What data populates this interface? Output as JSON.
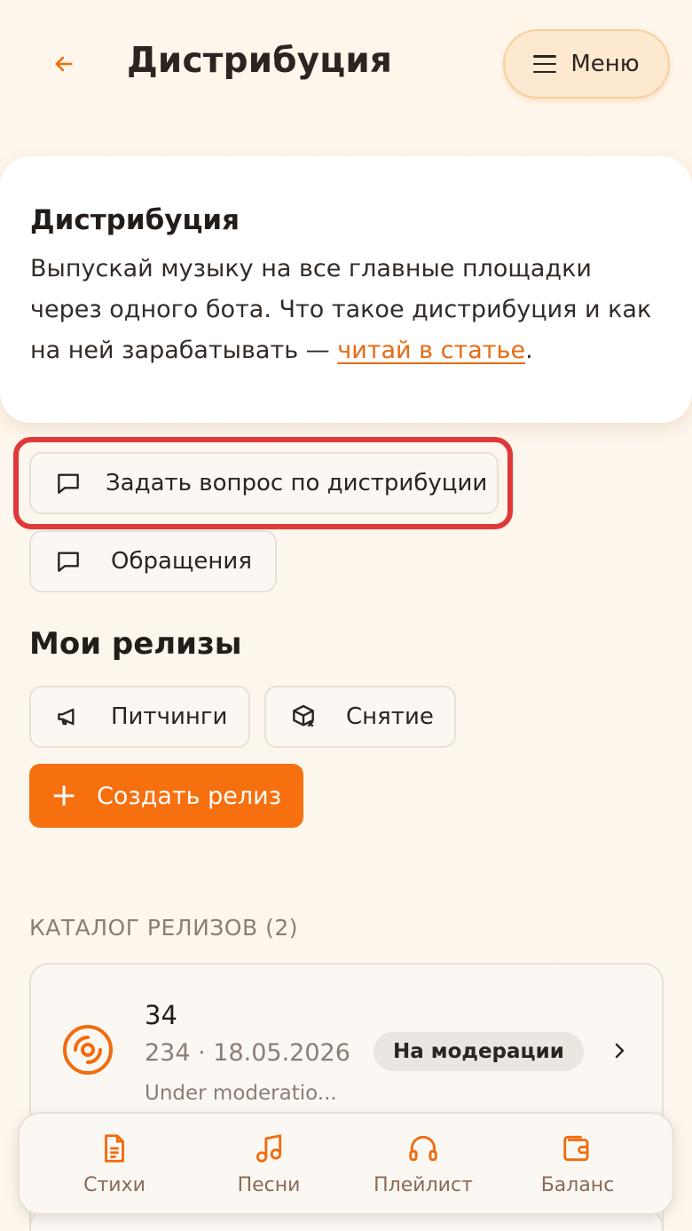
{
  "header": {
    "title": "Дистрибуция",
    "menu_label": "Меню"
  },
  "intro": {
    "title": "Дистрибуция",
    "text": " Выпускай музыку на все главные площадки через одного бота. Что такое дистрибуция и как на ней зарабатывать — ",
    "link": "читай в статье",
    "tail": "."
  },
  "actions": {
    "ask_question": "Задать вопрос по дистрибуции",
    "requests": "Обращения"
  },
  "releases": {
    "section_title": "Мои релизы",
    "pitching": "Питчинги",
    "withdrawal": "Снятие",
    "create": "Создать релиз",
    "catalog_label": "КАТАЛОГ РЕЛИЗОВ (2)",
    "items": [
      {
        "title": "34",
        "meta": "234 · 18.05.2026",
        "subtitle": "Under moderatio...",
        "status": "На модерации"
      }
    ]
  },
  "bottom_nav": {
    "items": [
      {
        "label": "Стихи",
        "icon": "document-icon"
      },
      {
        "label": "Песни",
        "icon": "music-note-icon"
      },
      {
        "label": "Плейлист",
        "icon": "headphones-icon"
      },
      {
        "label": "Баланс",
        "icon": "wallet-icon"
      }
    ]
  },
  "colors": {
    "accent": "#f7700f",
    "highlight": "#e0383a"
  }
}
